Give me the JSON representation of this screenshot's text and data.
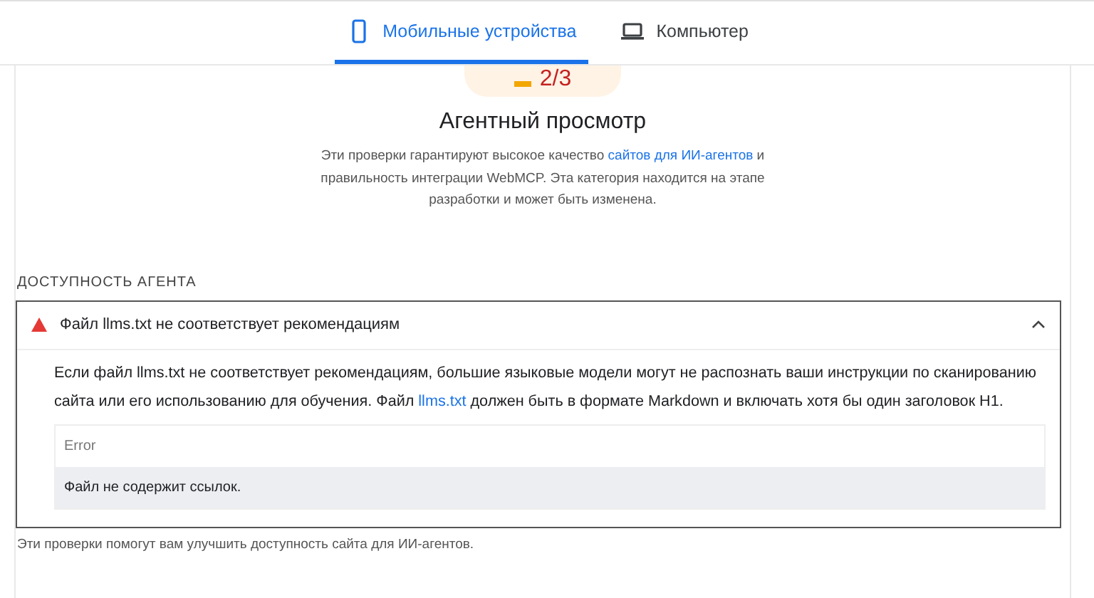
{
  "tabs": [
    {
      "label": "Мобильные устройства",
      "selected": true
    },
    {
      "label": "Компьютер",
      "selected": false
    }
  ],
  "score": {
    "value": "2/3"
  },
  "category": {
    "title": "Агентный просмотр",
    "description": "Эти проверки гарантируют высокое качество ",
    "link": "сайтов для ИИ-агентов",
    "description_end": " и правильность интеграции WebMCP. Эта категория находится на этапе разработки и может быть изменена."
  },
  "section": {
    "title": "ДОСТУПНОСТЬ АГЕНТА",
    "audits": [
      {
        "title": "Файл llms.txt не соответствует рекомендациям",
        "expanded": true,
        "text": "Если файл llms.txt не соответствует рекомендациям, большие языковые модели могут не распознать ваши инструкции по сканированию сайта или его использованию для обучения. Файл ",
        "link": "llms.txt",
        "text_end": " должен быть в формате Markdown и включать хотя бы один заголовок H1.",
        "table": {
          "columns": [
            "Error"
          ],
          "rows": [
            "Файл не содержит ссылок."
          ]
        }
      }
    ],
    "footer": "Эти проверки помогут вам улучшить доступность сайта для ИИ-агентов."
  }
}
